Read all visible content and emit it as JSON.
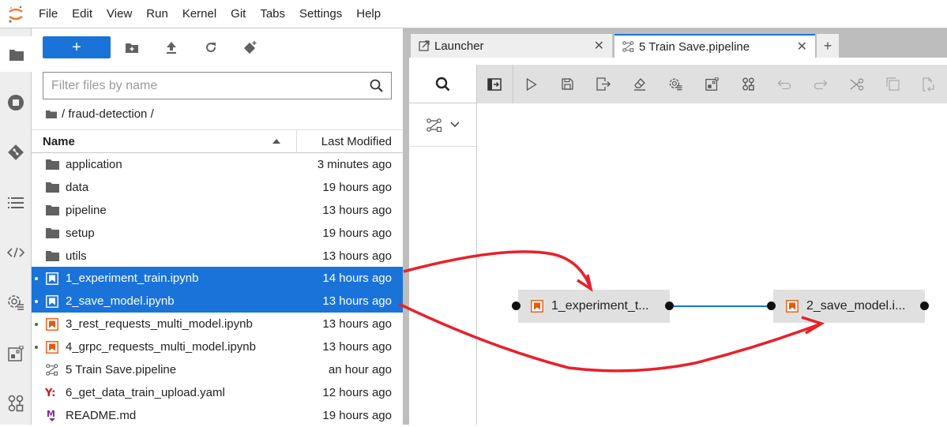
{
  "menubar": {
    "items": [
      "File",
      "Edit",
      "View",
      "Run",
      "Kernel",
      "Git",
      "Tabs",
      "Settings",
      "Help"
    ]
  },
  "activity_bar": {
    "items": [
      "folder-icon",
      "running-icon",
      "git-icon",
      "toc-icon",
      "code-snippets-icon",
      "runtimes-icon",
      "component-catalog-icon",
      "pipeline-components-icon"
    ]
  },
  "filebrowser": {
    "new_label": "+",
    "filter_placeholder": "Filter files by name",
    "breadcrumb": "/ fraud-detection /",
    "columns": {
      "name": "Name",
      "modified": "Last Modified"
    },
    "files": [
      {
        "name": "application",
        "modified": "3 minutes ago",
        "type": "folder",
        "selected": false,
        "running": false
      },
      {
        "name": "data",
        "modified": "19 hours ago",
        "type": "folder",
        "selected": false,
        "running": false
      },
      {
        "name": "pipeline",
        "modified": "13 hours ago",
        "type": "folder",
        "selected": false,
        "running": false
      },
      {
        "name": "setup",
        "modified": "19 hours ago",
        "type": "folder",
        "selected": false,
        "running": false
      },
      {
        "name": "utils",
        "modified": "13 hours ago",
        "type": "folder",
        "selected": false,
        "running": false
      },
      {
        "name": "1_experiment_train.ipynb",
        "modified": "14 hours ago",
        "type": "notebook",
        "selected": true,
        "running": true
      },
      {
        "name": "2_save_model.ipynb",
        "modified": "13 hours ago",
        "type": "notebook",
        "selected": true,
        "running": true
      },
      {
        "name": "3_rest_requests_multi_model.ipynb",
        "modified": "13 hours ago",
        "type": "notebook",
        "selected": false,
        "running": true
      },
      {
        "name": "4_grpc_requests_multi_model.ipynb",
        "modified": "13 hours ago",
        "type": "notebook",
        "selected": false,
        "running": true
      },
      {
        "name": "5 Train Save.pipeline",
        "modified": "an hour ago",
        "type": "pipeline",
        "selected": false,
        "running": false
      },
      {
        "name": "6_get_data_train_upload.yaml",
        "modified": "12 hours ago",
        "type": "yaml",
        "selected": false,
        "running": false
      },
      {
        "name": "README.md",
        "modified": "19 hours ago",
        "type": "markdown",
        "selected": false,
        "running": false
      }
    ]
  },
  "tabs": [
    {
      "label": "Launcher",
      "icon": "launcher-icon",
      "active": false
    },
    {
      "label": "5 Train Save.pipeline",
      "icon": "pipeline-icon",
      "active": true
    }
  ],
  "pipeline_toolbar": [
    "open-panel-icon",
    "run-icon",
    "save-icon",
    "export-icon",
    "clear-icon",
    "runtimes-icon",
    "component-catalog-icon",
    "arrange-icon",
    "undo-icon",
    "redo-icon",
    "cut-icon",
    "copy-icon",
    "paste-icon"
  ],
  "pipeline": {
    "nodes": [
      {
        "label": "1_experiment_t...",
        "full": "1_experiment_train.ipynb"
      },
      {
        "label": "2_save_model.i...",
        "full": "2_save_model.ipynb"
      }
    ],
    "links": [
      {
        "from": 0,
        "to": 1
      }
    ]
  },
  "colors": {
    "accent": "#1a73d9",
    "notebook_orange": "#e8590c",
    "annotation_red": "#e8202a",
    "running_green": "#2e7d32"
  }
}
